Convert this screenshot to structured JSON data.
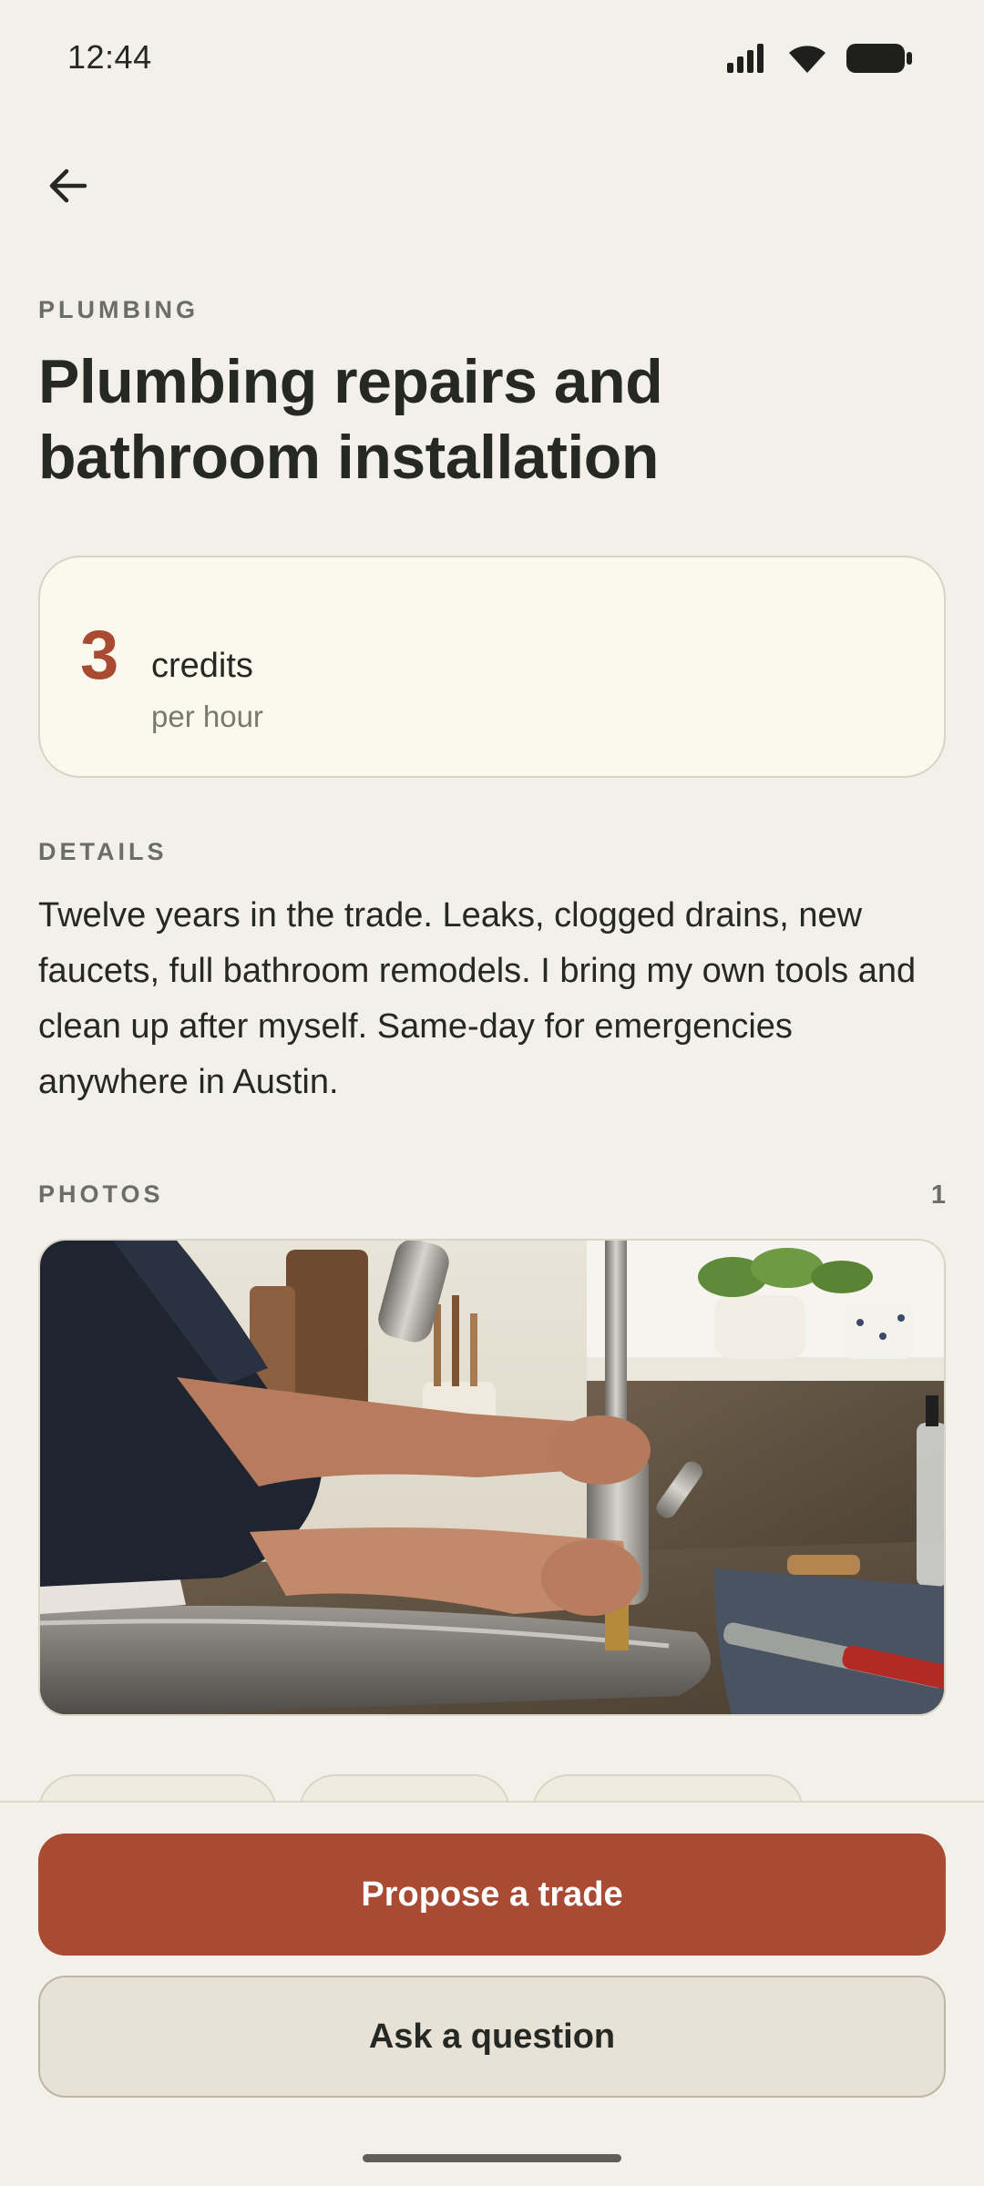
{
  "status": {
    "time": "12:44",
    "icons": [
      "signal-icon",
      "wifi-icon",
      "battery-icon"
    ]
  },
  "nav": {
    "back_icon": "arrow-left-icon"
  },
  "listing": {
    "category": "PLUMBING",
    "title": "Plumbing repairs and bathroom installation",
    "price": {
      "amount": "3",
      "unit": "credits",
      "rate": "per hour"
    },
    "details_label": "DETAILS",
    "details_text": "Twelve years in the trade. Leaks, clogged drains, new faucets, full bathroom remodels. I bring my own tools and clean up after myself. Same-day for emergencies anywhere in Austin.",
    "photos_label": "PHOTOS",
    "photos_count": "1"
  },
  "actions": {
    "primary_label": "Propose a trade",
    "secondary_label": "Ask a question"
  },
  "colors": {
    "background": "#f2f0e8",
    "accent": "#a94a32",
    "text": "#262824",
    "muted": "#6b6e67"
  }
}
